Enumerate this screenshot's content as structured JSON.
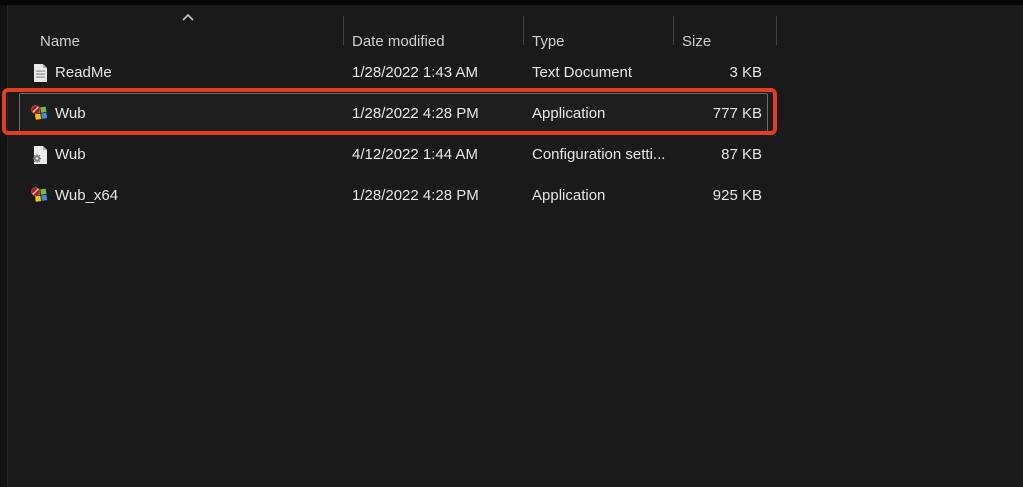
{
  "header": {
    "columns": [
      {
        "label": "Name"
      },
      {
        "label": "Date modified"
      },
      {
        "label": "Type"
      },
      {
        "label": "Size"
      }
    ],
    "sort": {
      "column": "Name",
      "direction": "ascending",
      "icon": "chevron-up-icon"
    }
  },
  "files": [
    {
      "name": "ReadMe",
      "date_modified": "1/28/2022 1:43 AM",
      "type": "Text Document",
      "size": "3 KB",
      "icon": "text-document-icon",
      "selected": false
    },
    {
      "name": "Wub",
      "date_modified": "1/28/2022 4:28 PM",
      "type": "Application",
      "size": "777 KB",
      "icon": "wub-application-icon",
      "selected": true
    },
    {
      "name": "Wub",
      "date_modified": "4/12/2022 1:44 AM",
      "type": "Configuration setti...",
      "size": "87 KB",
      "icon": "configuration-settings-icon",
      "selected": false
    },
    {
      "name": "Wub_x64",
      "date_modified": "1/28/2022 4:28 PM",
      "type": "Application",
      "size": "925 KB",
      "icon": "wub-application-icon",
      "selected": false
    }
  ],
  "annotation": {
    "shape": "rectangle",
    "color": "#e23e1e",
    "highlighted_row": "Wub — Application — 777 KB"
  },
  "colors": {
    "background": "#1a1a1a",
    "header_text": "#cfcfcf",
    "row_text": "#e6e6e6",
    "column_divider": "#424242",
    "selection_border": "#6d6d6d",
    "highlight_red": "#e23e1e"
  }
}
